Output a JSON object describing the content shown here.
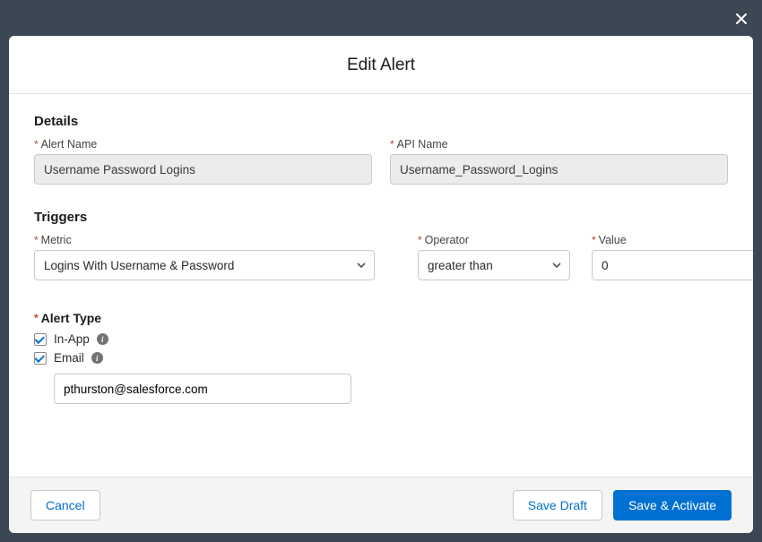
{
  "header": {
    "title": "Edit Alert"
  },
  "sections": {
    "details": {
      "title": "Details",
      "fields": {
        "alert_name": {
          "label": "Alert Name",
          "value": "Username Password Logins"
        },
        "api_name": {
          "label": "API Name",
          "value": "Username_Password_Logins"
        }
      }
    },
    "triggers": {
      "title": "Triggers",
      "fields": {
        "metric": {
          "label": "Metric",
          "value": "Logins With Username & Password"
        },
        "operator": {
          "label": "Operator",
          "value": "greater than"
        },
        "value": {
          "label": "Value",
          "value": "0"
        }
      }
    },
    "alert_type": {
      "title": "Alert Type",
      "in_app": {
        "label": "In-App",
        "checked": true
      },
      "email": {
        "label": "Email",
        "checked": true,
        "address": "pthurston@salesforce.com"
      }
    }
  },
  "footer": {
    "cancel": "Cancel",
    "save_draft": "Save Draft",
    "save_activate": "Save & Activate"
  }
}
